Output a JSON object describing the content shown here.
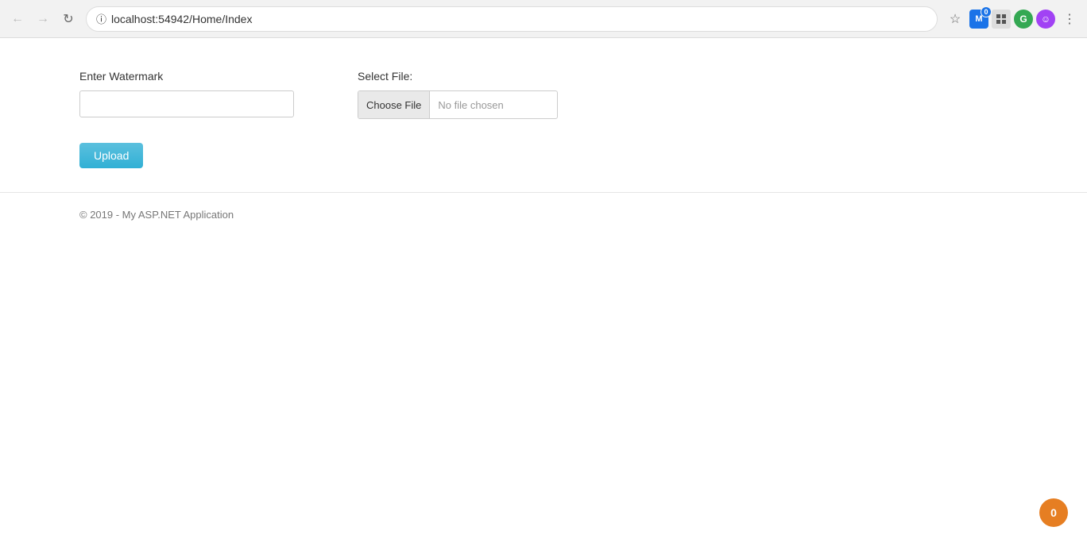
{
  "browser": {
    "url_host": "localhost:54942",
    "url_path": "/Home/Index",
    "url_display": "localhost:54942/Home/Index"
  },
  "header": {
    "watermark_label": "Enter Watermark",
    "file_label": "Select File:",
    "choose_file_btn": "Choose File",
    "no_file_text": "No file chosen",
    "upload_btn": "Upload"
  },
  "footer": {
    "copyright": "© 2019 - My ASP.NET Application"
  },
  "badge": {
    "value": "0"
  }
}
